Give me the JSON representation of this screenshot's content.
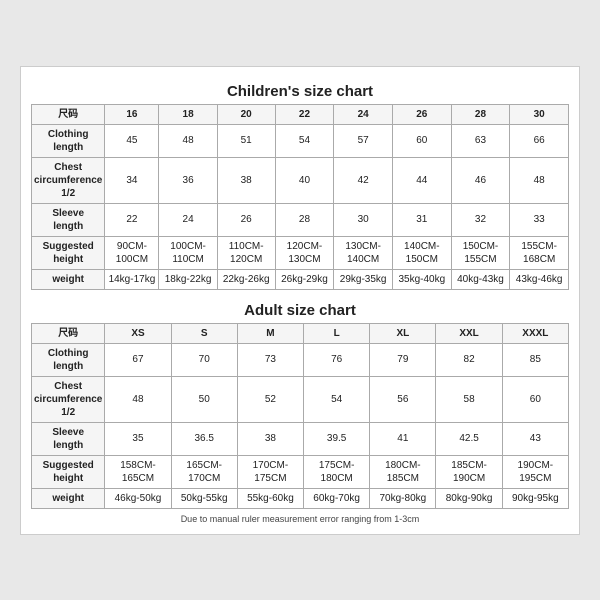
{
  "children": {
    "title": "Children's size chart",
    "headers": [
      "尺码",
      "16",
      "18",
      "20",
      "22",
      "24",
      "26",
      "28",
      "30"
    ],
    "rows": [
      {
        "label": "Clothing\nlength",
        "values": [
          "45",
          "48",
          "51",
          "54",
          "57",
          "60",
          "63",
          "66"
        ]
      },
      {
        "label": "Chest\ncircumference\n1/2",
        "values": [
          "34",
          "36",
          "38",
          "40",
          "42",
          "44",
          "46",
          "48"
        ]
      },
      {
        "label": "Sleeve\nlength",
        "values": [
          "22",
          "24",
          "26",
          "28",
          "30",
          "31",
          "32",
          "33"
        ]
      },
      {
        "label": "Suggested\nheight",
        "values": [
          "90CM-100CM",
          "100CM-110CM",
          "110CM-120CM",
          "120CM-130CM",
          "130CM-140CM",
          "140CM-150CM",
          "150CM-155CM",
          "155CM-168CM"
        ]
      },
      {
        "label": "weight",
        "values": [
          "14kg-17kg",
          "18kg-22kg",
          "22kg-26kg",
          "26kg-29kg",
          "29kg-35kg",
          "35kg-40kg",
          "40kg-43kg",
          "43kg-46kg"
        ]
      }
    ]
  },
  "adult": {
    "title": "Adult size chart",
    "headers": [
      "尺码",
      "XS",
      "S",
      "M",
      "L",
      "XL",
      "XXL",
      "XXXL"
    ],
    "rows": [
      {
        "label": "Clothing\nlength",
        "values": [
          "67",
          "70",
          "73",
          "76",
          "79",
          "82",
          "85"
        ]
      },
      {
        "label": "Chest\ncircumference\n1/2",
        "values": [
          "48",
          "50",
          "52",
          "54",
          "56",
          "58",
          "60"
        ]
      },
      {
        "label": "Sleeve\nlength",
        "values": [
          "35",
          "36.5",
          "38",
          "39.5",
          "41",
          "42.5",
          "43"
        ]
      },
      {
        "label": "Suggested\nheight",
        "values": [
          "158CM-165CM",
          "165CM-170CM",
          "170CM-175CM",
          "175CM-180CM",
          "180CM-185CM",
          "185CM-190CM",
          "190CM-195CM"
        ]
      },
      {
        "label": "weight",
        "values": [
          "46kg-50kg",
          "50kg-55kg",
          "55kg-60kg",
          "60kg-70kg",
          "70kg-80kg",
          "80kg-90kg",
          "90kg-95kg"
        ]
      }
    ]
  },
  "disclaimer": "Due to manual ruler measurement error ranging from 1-3cm"
}
